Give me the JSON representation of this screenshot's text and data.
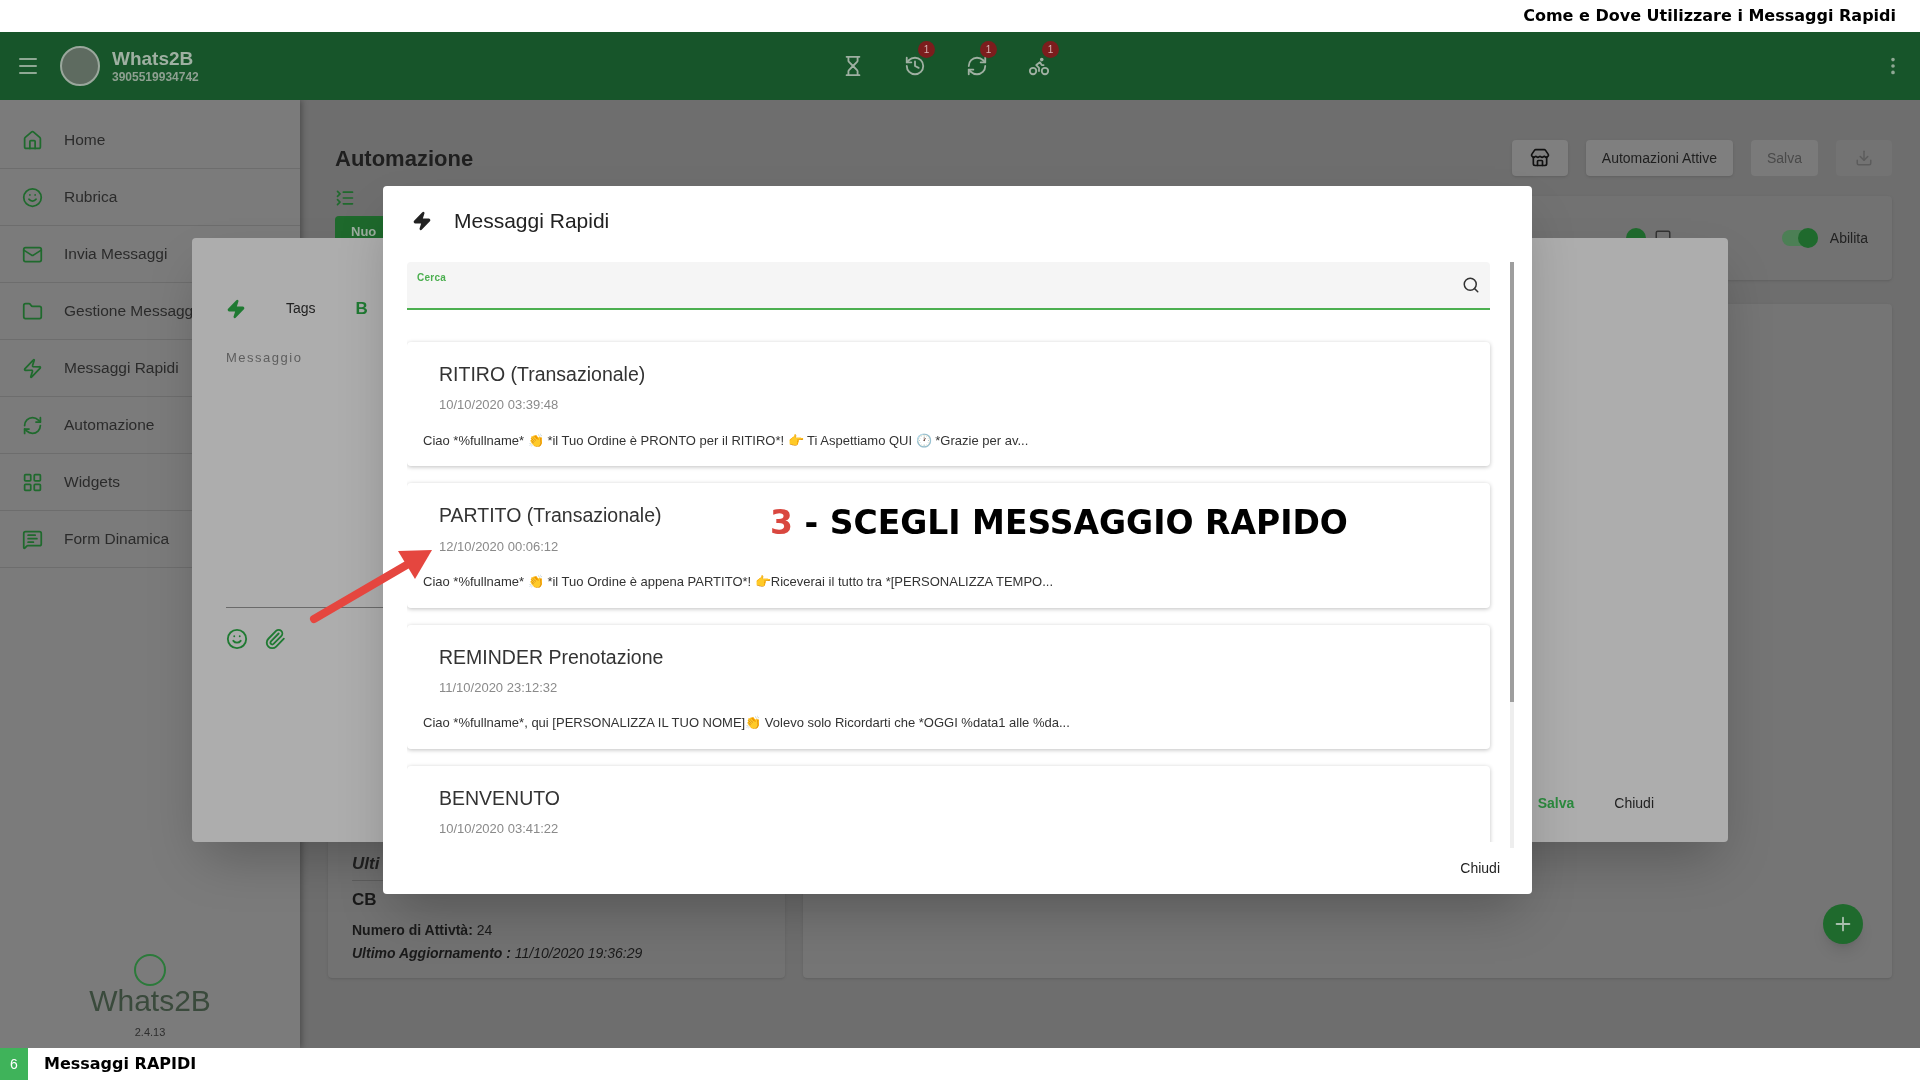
{
  "video_title": "Come e Dove Utilizzare i Messaggi Rapidi",
  "app_bar": {
    "app_name": "Whats2B",
    "phone": "3905519934742",
    "status_icons": [
      {
        "kind": "hourglass"
      },
      {
        "kind": "history",
        "badge": "1"
      },
      {
        "kind": "sync",
        "badge": "1"
      },
      {
        "kind": "vehicle",
        "badge": "1"
      }
    ]
  },
  "sidebar": {
    "items": [
      {
        "kind": "home",
        "label": "Home"
      },
      {
        "kind": "contacts",
        "label": "Rubrica"
      },
      {
        "kind": "mail",
        "label": "Invia Messaggi"
      },
      {
        "kind": "folder",
        "label": "Gestione Messagg"
      },
      {
        "kind": "bolt",
        "label": "Messaggi Rapidi"
      },
      {
        "kind": "sync",
        "label": "Automazione"
      },
      {
        "kind": "widgets",
        "label": "Widgets"
      },
      {
        "kind": "form",
        "label": "Form Dinamica"
      }
    ],
    "logo_text": "Whats2B",
    "version": "2.4.13"
  },
  "page": {
    "title": "Automazione",
    "new_button": "Nuo",
    "active_button": "Automazioni Attive",
    "save_button": {
      "label": "Salva",
      "disabled": true
    },
    "enable_toggle": {
      "label": "Abilita",
      "on": true
    },
    "summary": {
      "partial_title": "Ulti",
      "code": "CB",
      "count_label": "Numero di Attivtà:",
      "count": "24",
      "updated_label": "Ultimo Aggiornamento :",
      "updated": "11/10/2020 19:36:29"
    }
  },
  "editor_dialog": {
    "tags": "Tags",
    "bold": "B",
    "message_label": "Messaggio",
    "save": "Salva",
    "close": "Chiudi"
  },
  "quick_messages_dialog": {
    "title": "Messaggi Rapidi",
    "search": {
      "label": "Cerca"
    },
    "messages": [
      {
        "title": "RITIRO (Transazionale)",
        "date": "10/10/2020 03:39:48",
        "preview": "Ciao *%fullname* 👏 *il Tuo Ordine è PRONTO per il RITIRO*! 👉 Ti Aspettiamo QUI 🕐 *Grazie per av..."
      },
      {
        "title": "PARTITO (Transazionale)",
        "date": "12/10/2020 00:06:12",
        "preview": "Ciao *%fullname* 👏 *il Tuo Ordine è appena PARTITO*! 👉Riceverai il tutto tra *[PERSONALIZZA TEMPO..."
      },
      {
        "title": "REMINDER Prenotazione",
        "date": "11/10/2020 23:12:32",
        "preview": "Ciao *%fullname*, qui [PERSONALIZZA IL TUO NOME]👏 Volevo solo Ricordarti che *OGGI %data1 alle %da..."
      },
      {
        "title": "BENVENUTO",
        "date": "10/10/2020 03:41:22"
      }
    ],
    "close": "Chiudi"
  },
  "annotation": {
    "step": "3",
    "text": "- SCEGLI MESSAGGIO RAPIDO"
  },
  "footer": {
    "slide": "6",
    "title": "Messaggi RAPIDI"
  }
}
